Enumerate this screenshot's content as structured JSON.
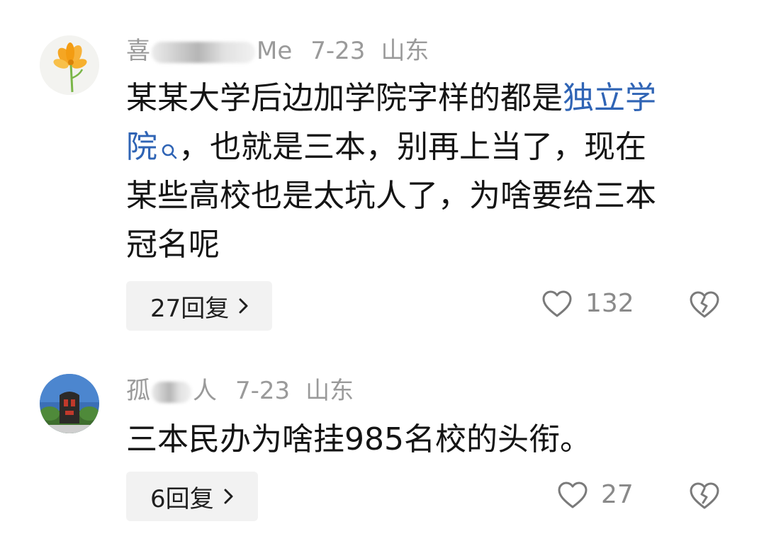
{
  "comments": [
    {
      "username_start": "喜",
      "username_end": "Me",
      "date": "7-23",
      "location": "山东",
      "text_before_link": "某某大学后边加学院字样的都是",
      "link_text_1": "独立学",
      "link_text_2": "院",
      "text_after_link": "，也就是三本，别再上当了，现在",
      "text_line3": "某些高校也是太坑人了，为啥要给三本",
      "text_line4": "冠名呢",
      "reply_label": "27回复",
      "like_count": "132",
      "avatar_icon": "flower-avatar-icon"
    },
    {
      "username_start": "孤",
      "username_end": "人",
      "date": "7-23",
      "location": "山东",
      "text": "三本民办为啥挂985名校的头衔。",
      "reply_label": "6回复",
      "like_count": "27",
      "avatar_icon": "monument-avatar-icon"
    }
  ],
  "colors": {
    "link": "#2f64b5",
    "meta": "#9a9a9a",
    "reply_bg": "#f2f2f2"
  }
}
